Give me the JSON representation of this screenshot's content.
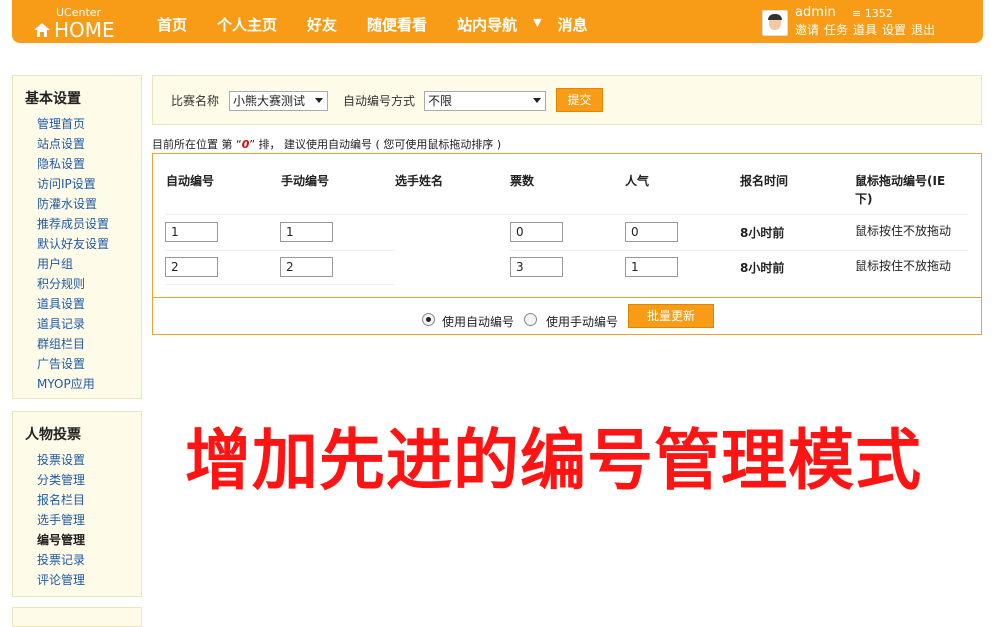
{
  "header": {
    "logo_small": "UCenter",
    "logo_big": "HOME",
    "nav": [
      "首页",
      "个人主页",
      "好友",
      "随便看看",
      "站内导航",
      "消息"
    ],
    "user": {
      "name": "admin",
      "coins": "1352",
      "links": [
        "邀请",
        "任务",
        "道具",
        "设置",
        "退出"
      ]
    }
  },
  "sidebar": [
    {
      "title": "基本设置",
      "items": [
        "管理首页",
        "站点设置",
        "隐私设置",
        "访问IP设置",
        "防灌水设置",
        "推荐成员设置",
        "默认好友设置",
        "用户组",
        "积分规则",
        "道具设置",
        "道具记录",
        "群组栏目",
        "广告设置",
        "MYOP应用"
      ]
    },
    {
      "title": "人物投票",
      "items": [
        "投票设置",
        "分类管理",
        "报名栏目",
        "选手管理",
        "编号管理",
        "投票记录",
        "评论管理"
      ],
      "active": "编号管理"
    }
  ],
  "filter": {
    "contest_label": "比赛名称",
    "contest_value": "小熊大赛测试",
    "mode_label": "自动编号方式",
    "mode_value": "不限",
    "submit": "提交"
  },
  "position_text": {
    "prefix": "目前所在位置 第 “",
    "value": "0",
    "suffix": "” 排， 建议使用自动编号 ( 您可使用鼠标拖动排序 )"
  },
  "table": {
    "headers": [
      "自动编号",
      "手动编号",
      "选手姓名",
      "票数",
      "人气",
      "报名时间",
      "鼠标拖动编号(IE",
      "下)"
    ],
    "rows": [
      {
        "auto": "1",
        "manual": "1",
        "name": "",
        "votes": "0",
        "pop": "0",
        "time": "8小时前",
        "drag": "鼠标按住不放拖动"
      },
      {
        "auto": "2",
        "manual": "2",
        "name": "",
        "votes": "3",
        "pop": "1",
        "time": "8小时前",
        "drag": "鼠标按住不放拖动"
      }
    ]
  },
  "footer": {
    "radio_auto": "使用自动编号",
    "radio_manual": "使用手动编号",
    "selected": "auto",
    "batch_button": "批量更新"
  },
  "promo": "增加先进的编号管理模式",
  "colors": {
    "accent": "#f89b17",
    "promo": "#ff1414",
    "link": "#1d5aa8"
  }
}
